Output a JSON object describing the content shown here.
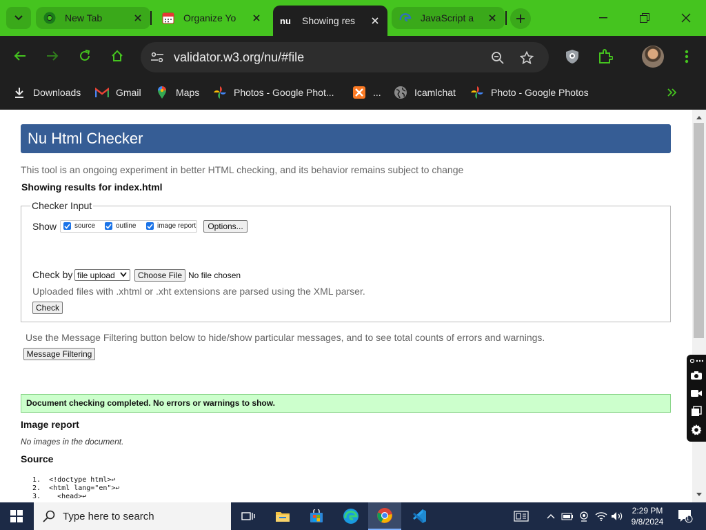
{
  "browser": {
    "tabs": [
      {
        "title": "New Tab",
        "icon": "chrome-icon"
      },
      {
        "title": "Organize Yo",
        "icon": "calendar-icon"
      },
      {
        "title": "Showing res",
        "icon": "nu-validator-icon",
        "active": true
      },
      {
        "title": "JavaScript a",
        "icon": "edge-icon"
      }
    ],
    "url": "validator.w3.org/nu/#file",
    "bookmarks": [
      {
        "label": "Downloads",
        "icon": "download-icon"
      },
      {
        "label": "Gmail",
        "icon": "gmail-icon"
      },
      {
        "label": "Maps",
        "icon": "maps-pin-icon"
      },
      {
        "label": "Photos - Google Phot...",
        "icon": "google-photos-icon"
      },
      {
        "label": "...",
        "icon": "xampp-icon"
      },
      {
        "label": "Icamlchat",
        "icon": "globe-icon"
      },
      {
        "label": "Photo - Google Photos",
        "icon": "google-photos-icon"
      }
    ],
    "accent_color": "#45c41f",
    "toolbar_color": "#1f1f1f"
  },
  "page": {
    "title": "Nu Html Checker",
    "intro": "This tool is an ongoing experiment in better HTML checking, and its behavior remains subject to change",
    "results_for": "Showing results for index.html",
    "checker_input": {
      "legend": "Checker Input",
      "show_label": "Show",
      "options": [
        {
          "label": "source",
          "checked": true
        },
        {
          "label": "outline",
          "checked": true
        },
        {
          "label": "image report",
          "checked": true
        }
      ],
      "options_button": "Options...",
      "check_by_label": "Check by",
      "check_by_value": "file upload",
      "choose_file_button": "Choose File",
      "no_file": "No file chosen",
      "upload_note": "Uploaded files with .xhtml or .xht extensions are parsed using the XML parser.",
      "check_button": "Check"
    },
    "filter_note": "Use the Message Filtering button below to hide/show particular messages, and to see total counts of errors and warnings.",
    "filter_button": "Message Filtering",
    "success_message": "Document checking completed. No errors or warnings to show.",
    "image_report_heading": "Image report",
    "no_images": "No images in the document.",
    "source_heading": "Source",
    "source_lines": [
      "1.  <!doctype html>↩",
      "2.  <html lang=\"en\">↩",
      "3.    <head>↩"
    ],
    "header_color": "#365d95",
    "success_color": "#ccffcc"
  },
  "taskbar": {
    "search_placeholder": "Type here to search",
    "time": "2:29 PM",
    "date": "9/8/2024",
    "notification_count": "1"
  }
}
